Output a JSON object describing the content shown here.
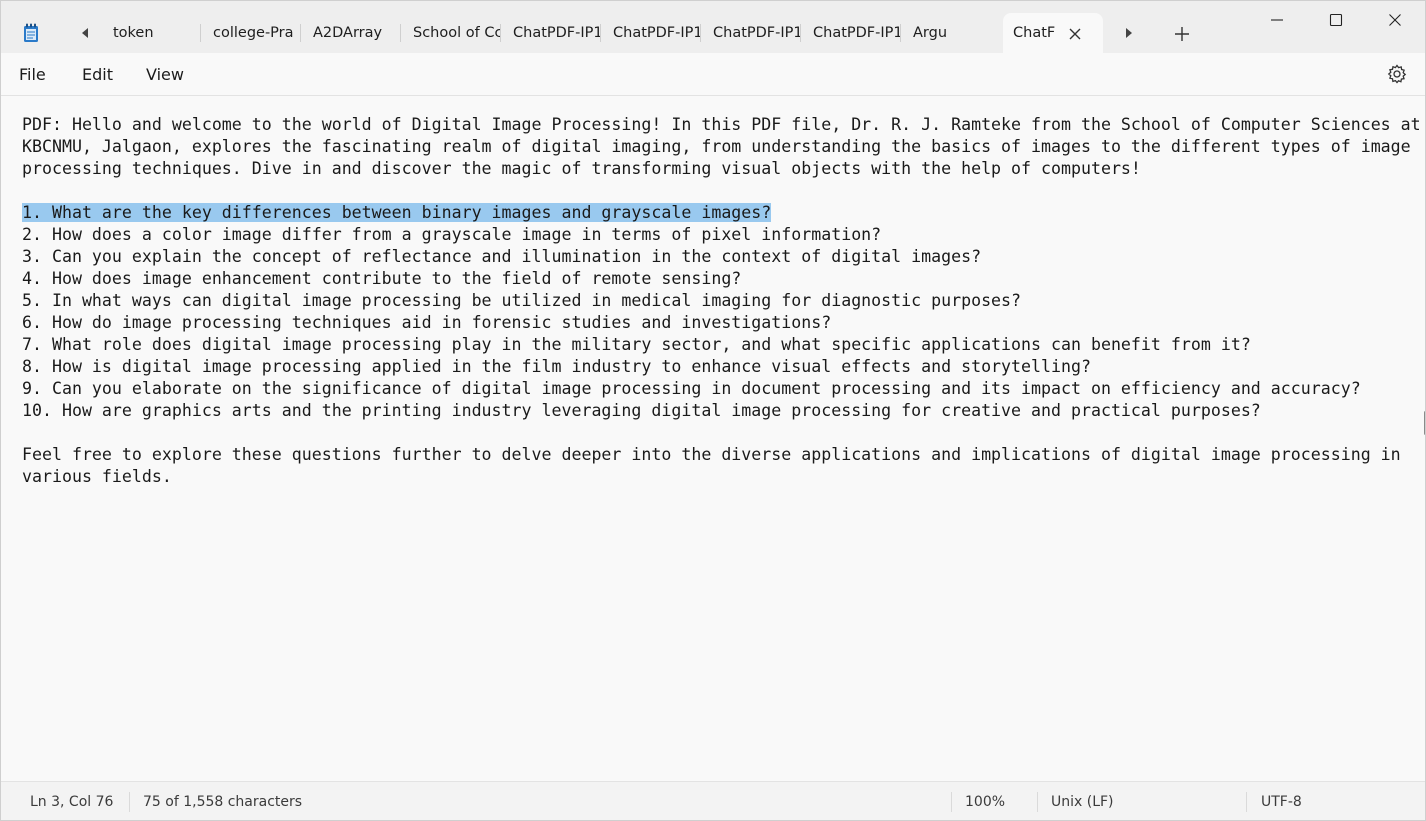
{
  "tabs": [
    {
      "label": "token"
    },
    {
      "label": "college-Pra"
    },
    {
      "label": "A2DArray"
    },
    {
      "label": "School of Cc"
    },
    {
      "label": "ChatPDF-IP1"
    },
    {
      "label": "ChatPDF-IP1"
    },
    {
      "label": "ChatPDF-IP1"
    },
    {
      "label": "ChatPDF-IP1"
    },
    {
      "label": "Argu"
    },
    {
      "label": "ChatF",
      "active": true
    }
  ],
  "menu": {
    "file": "File",
    "edit": "Edit",
    "view": "View"
  },
  "editor": {
    "lines": [
      "PDF: Hello and welcome to the world of Digital Image Processing! In this PDF file, Dr. R. J. Ramteke from the School of Computer Sciences at",
      "KBCNMU, Jalgaon, explores the fascinating realm of digital imaging, from understanding the basics of images to the different types of image",
      "processing techniques. Dive in and discover the magic of transforming visual objects with the help of computers!",
      "",
      "1. What are the key differences between binary images and grayscale images?",
      "2. How does a color image differ from a grayscale image in terms of pixel information?",
      "3. Can you explain the concept of reflectance and illumination in the context of digital images?",
      "4. How does image enhancement contribute to the field of remote sensing?",
      "5. In what ways can digital image processing be utilized in medical imaging for diagnostic purposes?",
      "6. How do image processing techniques aid in forensic studies and investigations?",
      "7. What role does digital image processing play in the military sector, and what specific applications can benefit from it?",
      "8. How is digital image processing applied in the film industry to enhance visual effects and storytelling?",
      "9. Can you elaborate on the significance of digital image processing in document processing and its impact on efficiency and accuracy?",
      "10. How are graphics arts and the printing industry leveraging digital image processing for creative and practical purposes?",
      "",
      "Feel free to explore these questions further to delve deeper into the diverse applications and implications of digital image processing in",
      "various fields."
    ],
    "selected_line": 4
  },
  "status": {
    "position": "Ln 3, Col 76",
    "characters": "75 of 1,558 characters",
    "zoom": "100%",
    "line_ending": "Unix (LF)",
    "encoding": "UTF-8"
  },
  "colors": {
    "selection": "#99c9ef",
    "titlebar": "#eeeeee",
    "editor_bg": "#f9f9f9",
    "app_icon": "#1e6fb8"
  }
}
